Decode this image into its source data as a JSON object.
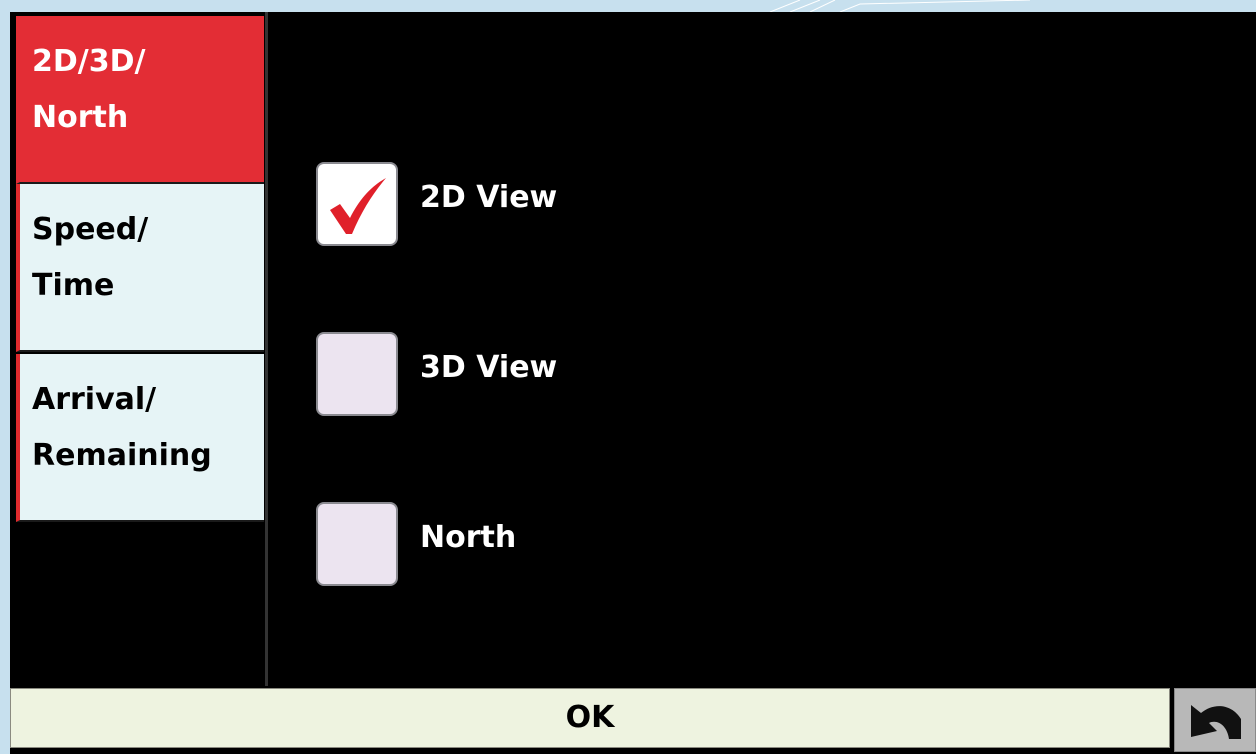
{
  "sidebar": {
    "items": [
      {
        "lines": [
          "2D/3D/",
          "North"
        ],
        "active": true
      },
      {
        "lines": [
          "Speed/",
          "Time"
        ],
        "active": false
      },
      {
        "lines": [
          "Arrival/",
          "Remaining"
        ],
        "active": false
      }
    ]
  },
  "options": [
    {
      "label": "2D View",
      "checked": true
    },
    {
      "label": "3D View",
      "checked": false
    },
    {
      "label": "North",
      "checked": false
    }
  ],
  "footer": {
    "ok_label": "OK",
    "back_icon": "back-arrow-icon"
  },
  "colors": {
    "active_tab": "#e32d35",
    "inactive_tab": "#e6f4f6",
    "checkmark": "#e0202a",
    "background": "#000000"
  }
}
